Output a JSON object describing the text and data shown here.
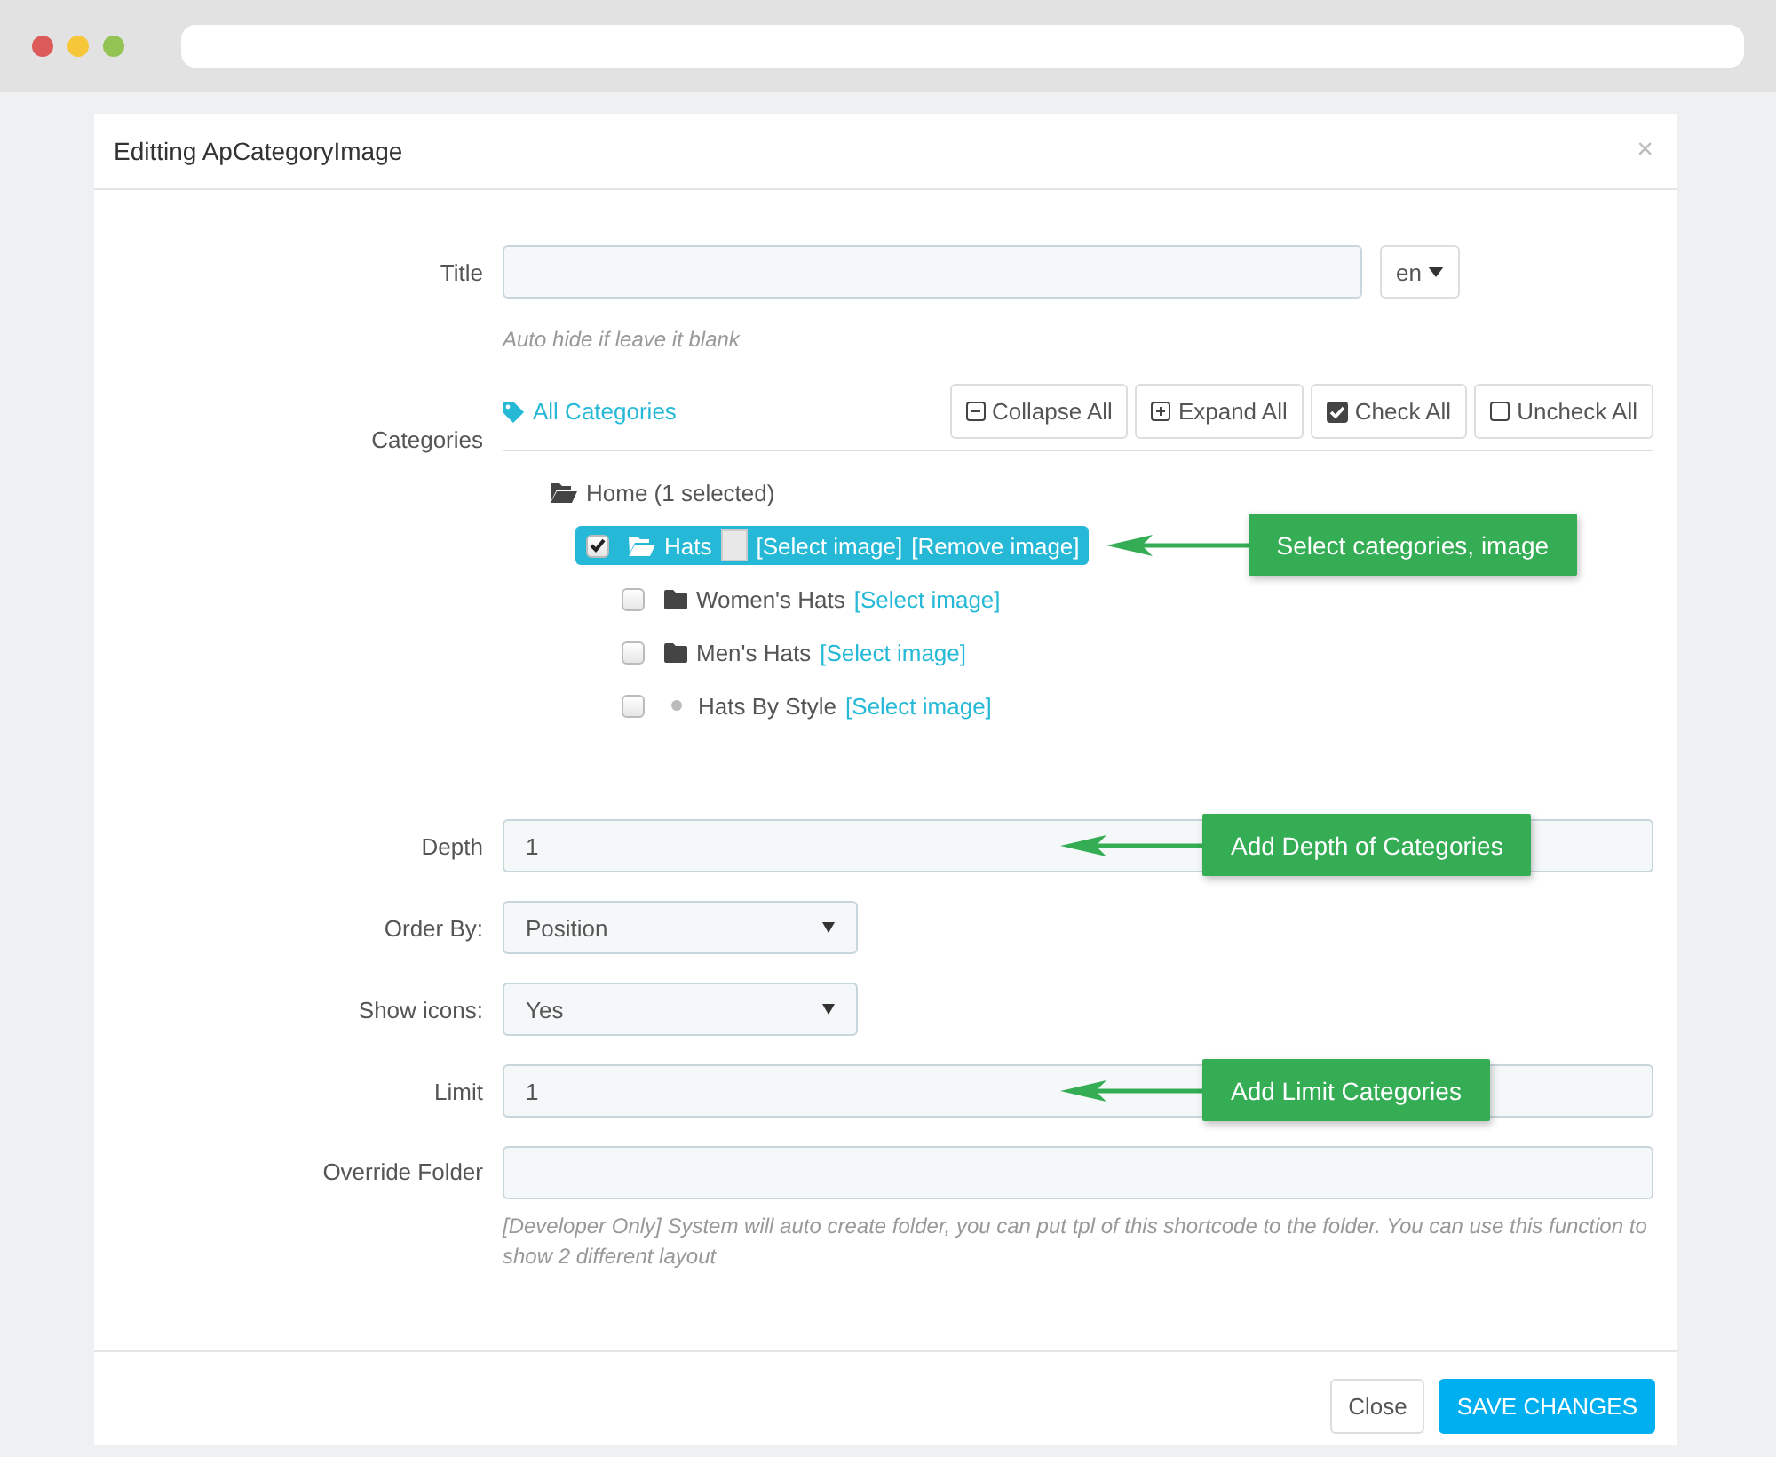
{
  "dialog": {
    "title": "Editting ApCategoryImage",
    "close": "×"
  },
  "fields": [
    {
      "kind": "text",
      "label": "Title",
      "language": "en",
      "help": "Auto hide if leave it blank"
    },
    {
      "kind": "categories",
      "label": "Categories",
      "filter_link": "All Categories",
      "actions": [
        {
          "kind": "collapse",
          "label": "Collapse All"
        },
        {
          "kind": "expand",
          "label": "Expand All"
        },
        {
          "kind": "check",
          "label": "Check All"
        },
        {
          "kind": "uncheck",
          "label": "Uncheck All"
        }
      ],
      "tree": [
        {
          "kind": "root",
          "label": "Home (1 selected)",
          "expanded": true,
          "children": [
            {
              "kind": "folder",
              "label": "Hats",
              "expanded": true,
              "checked": true,
              "selected": true,
              "has_image": true,
              "links": [
                "[Select image]",
                "[Remove image]"
              ],
              "callout": "Select categories, image",
              "children": [
                {
                  "kind": "folder",
                  "label": "Women's Hats",
                  "expanded": false,
                  "checked": false,
                  "selected": false,
                  "has_image": false,
                  "links": [
                    "[Select image]"
                  ]
                },
                {
                  "kind": "folder",
                  "label": "Men's Hats",
                  "expanded": false,
                  "checked": false,
                  "selected": false,
                  "has_image": false,
                  "links": [
                    "[Select image]"
                  ]
                },
                {
                  "kind": "leaf",
                  "label": "Hats By Style",
                  "checked": false,
                  "selected": false,
                  "has_image": false,
                  "links": [
                    "[Select image]"
                  ]
                }
              ]
            }
          ]
        }
      ]
    },
    {
      "kind": "text",
      "label": "Depth",
      "value": "1",
      "callout": "Add Depth of Categories"
    },
    {
      "kind": "select",
      "label": "Order By:",
      "value": "Position"
    },
    {
      "kind": "select",
      "label": "Show icons:",
      "value": "Yes"
    },
    {
      "kind": "text",
      "label": "Limit",
      "value": "1",
      "callout": "Add Limit Categories"
    },
    {
      "kind": "text",
      "label": "Override Folder",
      "help": "[Developer Only] System will auto create folder, you can put tpl of this shortcode to the folder. You can use this function to show 2 different layout"
    }
  ],
  "footer": [
    {
      "kind": "default",
      "label": "Close"
    },
    {
      "kind": "primary",
      "label": "SAVE CHANGES"
    }
  ]
}
